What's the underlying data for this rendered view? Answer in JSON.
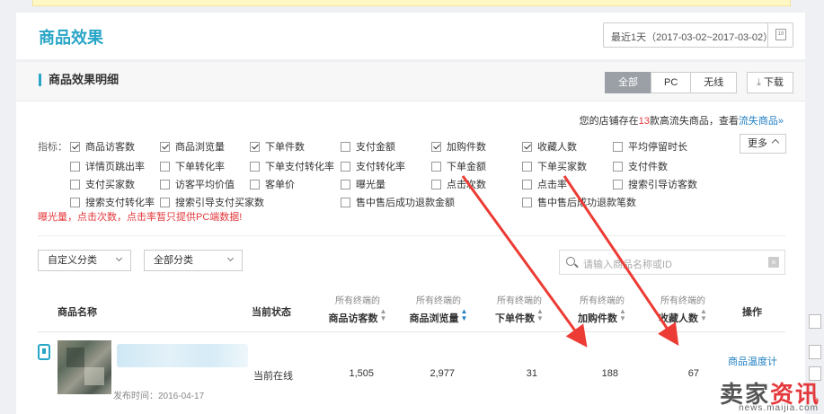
{
  "header": {
    "title": "商品效果",
    "date_range": "最近1天（2017-03-02~2017-03-02）",
    "calendar_day": "18"
  },
  "section": {
    "title": "商品效果明细",
    "tabs": [
      {
        "label": "全部",
        "active": true
      },
      {
        "label": "PC"
      },
      {
        "label": "无线"
      }
    ],
    "download": "下载"
  },
  "notice": {
    "prefix": "您的店铺存在",
    "count": "13",
    "middle": "款高流失商品，查看",
    "link": "流失商品",
    "suffix": "»"
  },
  "metrics": {
    "label": "指标：",
    "items": [
      {
        "label": "商品访客数",
        "checked": true
      },
      {
        "label": "商品浏览量",
        "checked": true
      },
      {
        "label": "下单件数",
        "checked": true
      },
      {
        "label": "支付金额",
        "checked": false
      },
      {
        "label": "加购件数",
        "checked": true
      },
      {
        "label": "收藏人数",
        "checked": true
      },
      {
        "label": "平均停留时长",
        "checked": false
      },
      {
        "label": "详情页跳出率",
        "checked": false
      },
      {
        "label": "下单转化率",
        "checked": false
      },
      {
        "label": "下单支付转化率",
        "checked": false
      },
      {
        "label": "支付转化率",
        "checked": false
      },
      {
        "label": "下单金额",
        "checked": false
      },
      {
        "label": "下单买家数",
        "checked": false
      },
      {
        "label": "支付件数",
        "checked": false
      },
      {
        "label": "支付买家数",
        "checked": false
      },
      {
        "label": "访客平均价值",
        "checked": false
      },
      {
        "label": "客单价",
        "checked": false
      },
      {
        "label": "曝光量",
        "checked": false
      },
      {
        "label": "点击次数",
        "checked": false
      },
      {
        "label": "点击率",
        "checked": false
      },
      {
        "label": "搜索引导访客数",
        "checked": false
      },
      {
        "label": "搜索支付转化率",
        "checked": false
      },
      {
        "label": "搜索引导支付买家数",
        "checked": false
      },
      {
        "label": "售中售后成功退款金额",
        "checked": false
      },
      {
        "label": "售中售后成功退款笔数",
        "checked": false
      }
    ],
    "more": "更多",
    "warning": "曝光量，点击次数，点击率暂只提供PC端数据!"
  },
  "filters": {
    "custom_category": "自定义分类",
    "all_category": "全部分类",
    "search_placeholder": "请输入商品名称或ID"
  },
  "table": {
    "columns": {
      "name": "商品名称",
      "status": "当前状态",
      "sub": "所有终端的",
      "visitors": "商品访客数",
      "pageviews": "商品浏览量",
      "orders": "下单件数",
      "cart": "加购件数",
      "favorites": "收藏人数",
      "ops": "操作"
    },
    "row": {
      "publish_time": "发布时间：2016-04-17",
      "status": "当前在线",
      "visitors": "1,505",
      "pageviews": "2,977",
      "orders": "31",
      "cart": "188",
      "favorites": "67",
      "op": "商品温度计"
    }
  },
  "watermark": {
    "brand_dark": "卖家",
    "brand_red": "资讯",
    "url": "news.maijia.com"
  },
  "colors": {
    "accent": "#29a5c7",
    "link": "#1f7fc2",
    "alert": "#e4393c",
    "arrow": "#ec3b34"
  }
}
